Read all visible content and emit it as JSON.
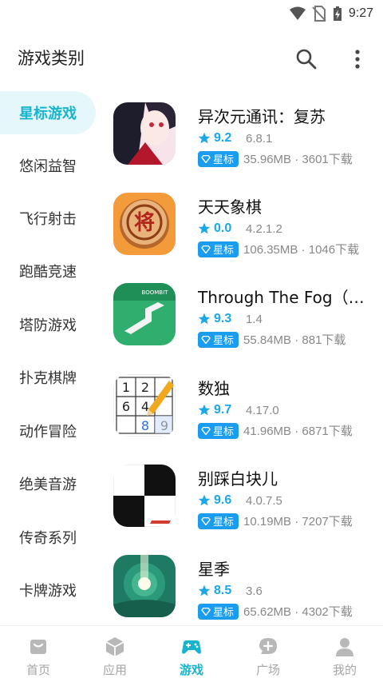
{
  "status": {
    "time": "9:27"
  },
  "header": {
    "title": "游戏类别"
  },
  "sidebar": {
    "items": [
      {
        "label": "星标游戏",
        "active": true
      },
      {
        "label": "悠闲益智"
      },
      {
        "label": "飞行射击"
      },
      {
        "label": "跑酷竞速"
      },
      {
        "label": "塔防游戏"
      },
      {
        "label": "扑克棋牌"
      },
      {
        "label": "动作冒险"
      },
      {
        "label": "绝美音游"
      },
      {
        "label": "传奇系列"
      },
      {
        "label": "卡牌游戏"
      }
    ]
  },
  "games": [
    {
      "name": "异次元通讯：复苏",
      "score": "9.2",
      "version": "6.8.1",
      "badge": "星标",
      "meta": "35.96MB · 3601下载",
      "icon": "anime-girl-icon"
    },
    {
      "name": "天天象棋",
      "score": "0.0",
      "version": "4.2.1.2",
      "badge": "星标",
      "meta": "106.35MB · 1046下载",
      "icon": "chinese-chess-icon"
    },
    {
      "name": "Through The Fog（穿越迷雾）",
      "score": "9.3",
      "version": "1.4",
      "badge": "星标",
      "meta": "55.84MB · 881下载",
      "icon": "fog-path-icon"
    },
    {
      "name": "数独",
      "score": "9.7",
      "version": "4.17.0",
      "badge": "星标",
      "meta": "41.96MB · 6871下载",
      "icon": "sudoku-icon"
    },
    {
      "name": "别踩白块儿",
      "score": "9.6",
      "version": "4.0.7.5",
      "badge": "星标",
      "meta": "10.19MB · 7207下载",
      "icon": "piano-tiles-icon"
    },
    {
      "name": "星季",
      "score": "8.5",
      "version": "3.6",
      "badge": "星标",
      "meta": "65.62MB · 4302下载",
      "icon": "star-season-icon"
    }
  ],
  "tabs": [
    {
      "label": "首页",
      "icon": "home-icon"
    },
    {
      "label": "应用",
      "icon": "box-icon"
    },
    {
      "label": "游戏",
      "icon": "gamepad-icon",
      "active": true
    },
    {
      "label": "广场",
      "icon": "chat-icon"
    },
    {
      "label": "我的",
      "icon": "profile-icon"
    }
  ],
  "colors": {
    "accent": "#17b4cf",
    "score": "#1aa8e8",
    "badge": "#1a9cf0"
  }
}
